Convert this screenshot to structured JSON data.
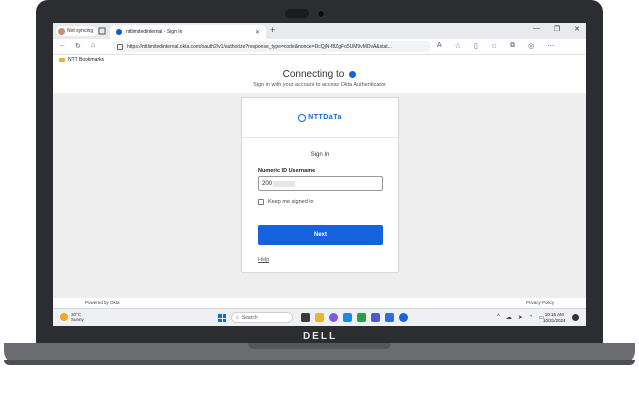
{
  "browser": {
    "profile_label": "Not syncing",
    "tab_title": "nttlimitedinternal - Sign In",
    "tab_close": "✕",
    "new_tab": "+",
    "window_controls": [
      "—",
      "❐",
      "✕"
    ],
    "url": "https://nttlimitedinternal.okta.com/oauth2/v1/authorize?response_type=code&nonce=DcQjN-f8ZgFo5UM9vMDvA&stat...",
    "nav": {
      "back": "←",
      "refresh": "↻",
      "home": "⌂"
    },
    "toolbar_icons": [
      "read-aloud-icon",
      "favorite-icon",
      "split-screen-icon",
      "favorites-icon",
      "collections-icon",
      "profile-icon",
      "more-icon"
    ],
    "bookmarks_bar": {
      "folder_label": "NTT Bookmarks"
    }
  },
  "page": {
    "heading": "Connecting to",
    "subheading": "Sign in with your account to access Okta Authenticator",
    "brand_name": "NTTDaTa",
    "signin_title": "Sign In",
    "username_label": "Numeric ID Username",
    "username_value": "200",
    "keep_signed_in_label": "Keep me signed in",
    "keep_signed_in_checked": false,
    "next_label": "Next",
    "help_label": "Help",
    "footer_left": "Powered by Okta",
    "footer_right": "Privacy Policy"
  },
  "taskbar": {
    "weather_temp": "30°C",
    "weather_desc": "Sunny",
    "search_placeholder": "Search",
    "time": "10:15 AM",
    "date": "10/31/2024"
  },
  "hardware": {
    "brand": "DELL"
  },
  "colors": {
    "accent": "#1662dd",
    "brand": "#0b6ad9"
  }
}
